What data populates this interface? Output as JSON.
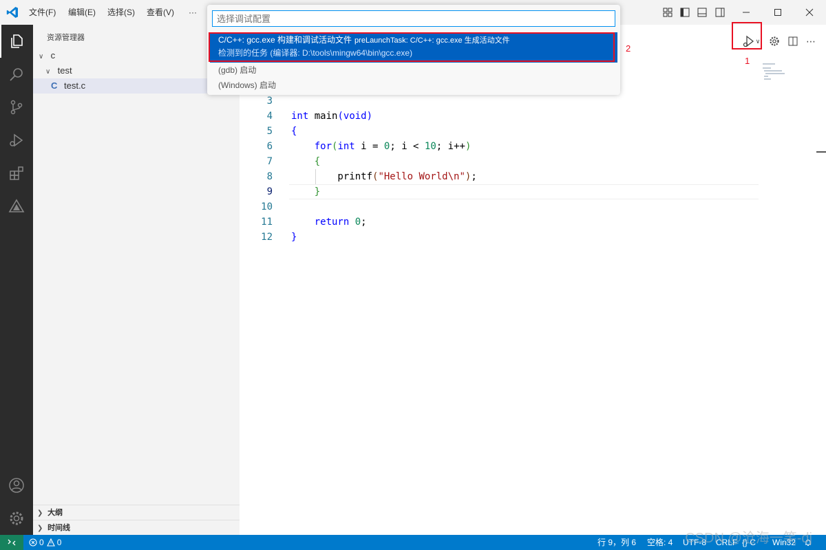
{
  "menubar": {
    "items": [
      "文件(F)",
      "编辑(E)",
      "选择(S)",
      "查看(V)",
      "···"
    ]
  },
  "sidebar": {
    "title": "资源管理器",
    "tree": [
      {
        "label": "c",
        "level": 0,
        "expanded": true
      },
      {
        "label": "test",
        "level": 1,
        "expanded": true
      },
      {
        "label": "test.c",
        "level": 2,
        "icon_letter": "C",
        "selected": true
      }
    ],
    "sections": [
      "大纲",
      "时间线"
    ]
  },
  "quick_pick": {
    "placeholder": "选择调试配置",
    "items": [
      {
        "label": "C/C++: gcc.exe 构建和调试活动文件",
        "description": "preLaunchTask: C/C++: gcc.exe 生成活动文件",
        "detail": "检测到的任务 (编译器: D:\\tools\\mingw64\\bin\\gcc.exe)",
        "selected": true
      },
      {
        "label": "(gdb) 启动"
      },
      {
        "label": "(Windows) 启动"
      }
    ]
  },
  "annotations": {
    "box1_label": "1",
    "box2_label": "2"
  },
  "editor": {
    "current_line": 9,
    "lines": [
      {
        "n": "3"
      },
      {
        "n": "4"
      },
      {
        "n": "5"
      },
      {
        "n": "6"
      },
      {
        "n": "7"
      },
      {
        "n": "8"
      },
      {
        "n": "9"
      },
      {
        "n": "10"
      },
      {
        "n": "11"
      },
      {
        "n": "12"
      }
    ]
  },
  "statusbar": {
    "problems": "0",
    "warnings": "0",
    "position": "行 9，列 6",
    "spaces": "空格: 4",
    "encoding": "UTF-8",
    "eol": "CRLF",
    "language": "{} C",
    "platform": "Win32"
  },
  "watermark": "CSDN @沧海一笑-dj",
  "colors": {
    "accent": "#007acc",
    "selection": "#0060c0",
    "annotation": "#e81123"
  }
}
